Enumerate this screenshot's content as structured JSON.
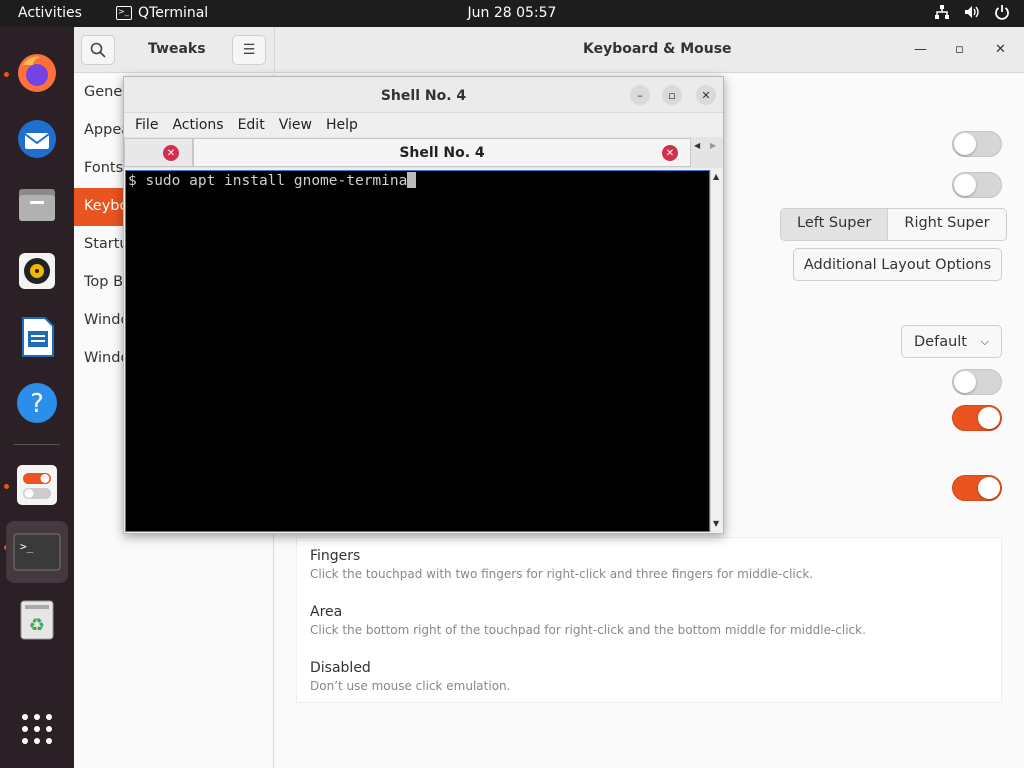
{
  "topbar": {
    "activities": "Activities",
    "app_name": "QTerminal",
    "clock": "Jun 28  05:57",
    "tray_icons": [
      "network-icon",
      "volume-icon",
      "power-icon"
    ]
  },
  "dock": {
    "apps": [
      "firefox",
      "thunderbird",
      "files",
      "rhythmbox",
      "libreoffice-writer",
      "help",
      "tweaks",
      "qterminal",
      "trash"
    ],
    "show_apps_icon": "app-grid-icon"
  },
  "tweaks": {
    "sidebar_title": "Tweaks",
    "window_title": "Keyboard & Mouse",
    "sidebar_items": [
      "Gener",
      "Appea",
      "Fonts",
      "Keybo",
      "Startu",
      "Top Ba",
      "Windo",
      "Windo"
    ],
    "active_index": 3,
    "overview_shortcut": {
      "options": [
        "Left Super",
        "Right Super"
      ],
      "selected": "Left Super"
    },
    "additional_layout_button": "Additional Layout Options",
    "accel_profile_value": "Default",
    "click_method": [
      {
        "title": "Fingers",
        "desc": "Click the touchpad with two fingers for right-click and three fingers for middle-click."
      },
      {
        "title": "Area",
        "desc": "Click the bottom right of the touchpad for right-click and the bottom middle for middle-click."
      },
      {
        "title": "Disabled",
        "desc": "Don’t use mouse click emulation."
      }
    ],
    "accent_color": "#e95420"
  },
  "qterminal": {
    "title": "Shell No. 4",
    "menu": [
      "File",
      "Actions",
      "Edit",
      "View",
      "Help"
    ],
    "active_tab": "Shell No. 4",
    "terminal_text": "$ sudo apt install gnome-termina"
  }
}
